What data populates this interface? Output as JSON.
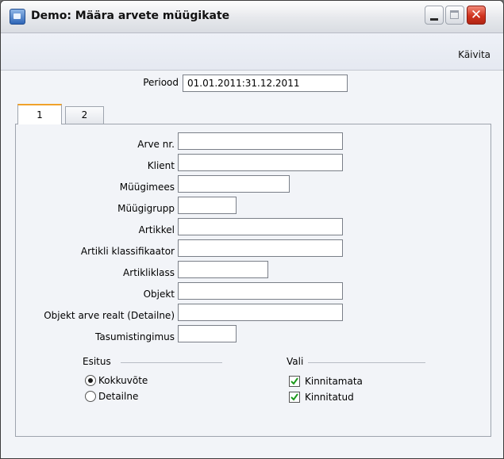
{
  "window": {
    "title": "Demo: Määra arvete müügikate",
    "close_glyph": "✕"
  },
  "toolbar": {
    "run_label": "Käivita"
  },
  "period": {
    "label": "Periood",
    "value": "01.01.2011:31.12.2011"
  },
  "tabs": [
    {
      "label": "1",
      "active": true
    },
    {
      "label": "2",
      "active": false
    }
  ],
  "fields": {
    "invoice_no": {
      "label": "Arve nr.",
      "value": ""
    },
    "customer": {
      "label": "Klient",
      "value": ""
    },
    "salesman": {
      "label": "Müügimees",
      "value": ""
    },
    "sales_group": {
      "label": "Müügigrupp",
      "value": ""
    },
    "item": {
      "label": "Artikkel",
      "value": ""
    },
    "item_classifier": {
      "label": "Artikli klassifikaator",
      "value": ""
    },
    "item_class": {
      "label": "Artikliklass",
      "value": ""
    },
    "object": {
      "label": "Objekt",
      "value": ""
    },
    "object_invoice_row": {
      "label": "Objekt arve realt (Detailne)",
      "value": ""
    },
    "payment_terms": {
      "label": "Tasumistingimus",
      "value": ""
    }
  },
  "esitus": {
    "title": "Esitus",
    "options": [
      {
        "label": "Kokkuvõte",
        "selected": true
      },
      {
        "label": "Detailne",
        "selected": false
      }
    ]
  },
  "vali": {
    "title": "Vali",
    "options": [
      {
        "label": "Kinnitamata",
        "checked": true
      },
      {
        "label": "Kinnitatud",
        "checked": true
      }
    ]
  }
}
